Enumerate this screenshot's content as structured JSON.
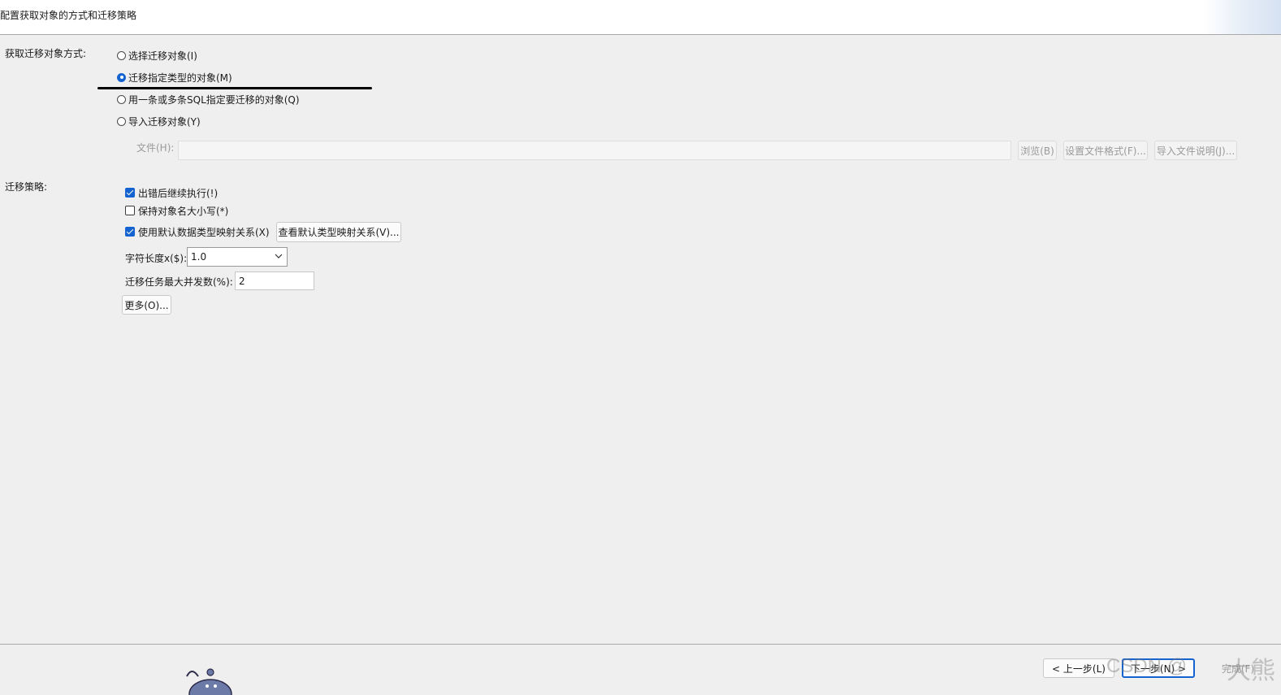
{
  "header": {
    "title": "配置获取对象的方式和迁移策略"
  },
  "acquisition": {
    "label": "获取迁移对象方式:",
    "options": [
      {
        "label": "选择迁移对象(I)",
        "selected": false
      },
      {
        "label": "迁移指定类型的对象(M)",
        "selected": true
      },
      {
        "label": "用一条或多条SQL指定要迁移的对象(Q)",
        "selected": false
      },
      {
        "label": "导入迁移对象(Y)",
        "selected": false
      }
    ],
    "file": {
      "label": "文件(H):",
      "value": "",
      "browse_label": "浏览(B)",
      "format_label": "设置文件格式(F)...",
      "import_desc_label": "导入文件说明(J)..."
    }
  },
  "strategy": {
    "label": "迁移策略:",
    "checkboxes": [
      {
        "label": "出错后继续执行(!)",
        "checked": true
      },
      {
        "label": "保持对象名大小写(*)",
        "checked": false
      },
      {
        "label": "使用默认数据类型映射关系(X)",
        "checked": true
      }
    ],
    "view_mapping_label": "查看默认类型映射关系(V)...",
    "char_length": {
      "label": "字符长度x($):",
      "value": "1.0"
    },
    "max_concurrency": {
      "label": "迁移任务最大并发数(%):",
      "value": "2"
    },
    "more_label": "更多(O)..."
  },
  "footer": {
    "back_label": "< 上一步(L)",
    "next_label": "下一步(N) >",
    "finish_label": "完成(F)"
  },
  "watermark": {
    "text": "CSDN @",
    "name": "大熊"
  },
  "colors": {
    "accent": "#1463d1",
    "background": "#efefef"
  }
}
